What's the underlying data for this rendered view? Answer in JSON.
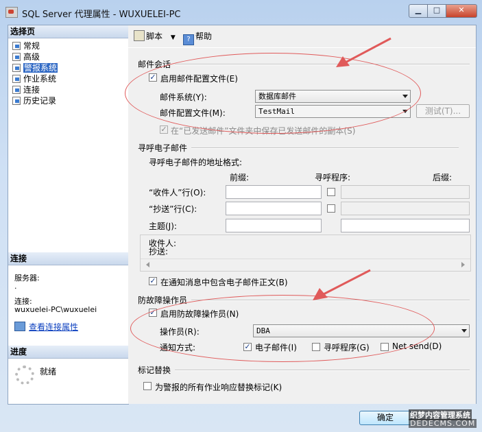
{
  "window": {
    "title": "SQL Server 代理属性 - WUXUELEI-PC"
  },
  "left": {
    "pages_header": "选择页",
    "pages": [
      {
        "label": "常规"
      },
      {
        "label": "高级"
      },
      {
        "label": "警报系统"
      },
      {
        "label": "作业系统"
      },
      {
        "label": "连接"
      },
      {
        "label": "历史记录"
      }
    ],
    "selected_page": "警报系统",
    "connection_header": "连接",
    "server_label": "服务器:",
    "server_value": ".",
    "connection_label": "连接:",
    "connection_value": "wuxuelei-PC\\wuxuelei",
    "view_connection_link": "查看连接属性",
    "progress_header": "进度",
    "progress_status": "就绪"
  },
  "toolbar": {
    "script_label": "脚本",
    "help_label": "帮助"
  },
  "mail_session": {
    "section_title": "邮件会话",
    "enable_profile_label": "启用邮件配置文件(E)",
    "enable_profile_checked": true,
    "mail_system_label": "邮件系统(Y):",
    "mail_system_value": "数据库邮件",
    "mail_profile_label": "邮件配置文件(M):",
    "mail_profile_value": "TestMail",
    "test_button_label": "测试(T)...",
    "save_copies_label": "在“已发送邮件”文件夹中保存已发送邮件的副本(S)",
    "save_copies_checked": true
  },
  "pager": {
    "section_title": "寻呼电子邮件",
    "address_format_label": "寻呼电子邮件的地址格式:",
    "col_prefix": "前缀:",
    "col_pager": "寻呼程序:",
    "col_suffix": "后缀:",
    "to_line_label": "“收件人”行(O):",
    "cc_line_label": "“抄送”行(C):",
    "subject_label": "主题(J):",
    "preview_to": "收件人:",
    "preview_cc": "抄送:",
    "include_body_label": "在通知消息中包含电子邮件正文(B)",
    "include_body_checked": true
  },
  "failsafe": {
    "section_title": "防故障操作员",
    "enable_label": "启用防故障操作员(N)",
    "enable_checked": true,
    "operator_label": "操作员(R):",
    "operator_value": "DBA",
    "notify_label": "通知方式:",
    "notify_email_label": "电子邮件(I)",
    "notify_email_checked": true,
    "notify_pager_label": "寻呼程序(G)",
    "notify_pager_checked": false,
    "notify_netsend_label": "Net send(D)",
    "notify_netsend_checked": false
  },
  "token": {
    "section_title": "标记替换",
    "replace_label": "为警报的所有作业响应替换标记(K)",
    "replace_checked": false
  },
  "footer": {
    "ok_label": "确定"
  },
  "watermark": {
    "line1": "织梦内容管理系统",
    "line2": "DEDECMS.COM"
  },
  "colors": {
    "selection": "#316ac5",
    "annotation": "#e05a5a"
  }
}
